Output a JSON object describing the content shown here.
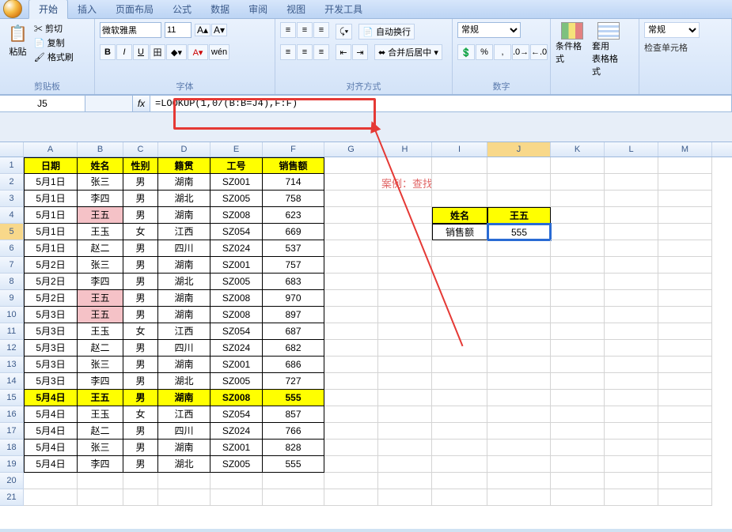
{
  "tabs": [
    "开始",
    "插入",
    "页面布局",
    "公式",
    "数据",
    "审阅",
    "视图",
    "开发工具"
  ],
  "tabs_active_index": 0,
  "ribbon": {
    "groups": {
      "clipboard": {
        "label": "剪贴板",
        "paste": "粘贴",
        "cut": "剪切",
        "copy": "复制",
        "format_painter": "格式刷"
      },
      "font": {
        "label": "字体",
        "name": "微软雅黑",
        "size": "11"
      },
      "align": {
        "label": "对齐方式",
        "wrap": "自动换行",
        "merge": "合并后居中"
      },
      "number": {
        "label": "数字",
        "format": "常规"
      },
      "styles": {
        "cond": "条件格式",
        "table": "套用\n表格格式",
        "cell_label": "常规",
        "check": "检查单元格"
      }
    }
  },
  "formula_bar": {
    "name_box": "J5",
    "formula": "=LOOKUP(1,0/(B:B=J4),F:F)"
  },
  "columns": [
    "A",
    "B",
    "C",
    "D",
    "E",
    "F",
    "G",
    "H",
    "I",
    "J",
    "K",
    "L",
    "M"
  ],
  "col_active_index": 9,
  "row_active_index": 5,
  "headers": [
    "日期",
    "姓名",
    "性别",
    "籍贯",
    "工号",
    "销售额"
  ],
  "rows": [
    {
      "d": "5月1日",
      "n": "张三",
      "g": "男",
      "p": "湖南",
      "id": "SZ001",
      "v": "714"
    },
    {
      "d": "5月1日",
      "n": "李四",
      "g": "男",
      "p": "湖北",
      "id": "SZ005",
      "v": "758"
    },
    {
      "d": "5月1日",
      "n": "王五",
      "g": "男",
      "p": "湖南",
      "id": "SZ008",
      "v": "623",
      "pink": true
    },
    {
      "d": "5月1日",
      "n": "王玉",
      "g": "女",
      "p": "江西",
      "id": "SZ054",
      "v": "669"
    },
    {
      "d": "5月1日",
      "n": "赵二",
      "g": "男",
      "p": "四川",
      "id": "SZ024",
      "v": "537"
    },
    {
      "d": "5月2日",
      "n": "张三",
      "g": "男",
      "p": "湖南",
      "id": "SZ001",
      "v": "757"
    },
    {
      "d": "5月2日",
      "n": "李四",
      "g": "男",
      "p": "湖北",
      "id": "SZ005",
      "v": "683"
    },
    {
      "d": "5月2日",
      "n": "王五",
      "g": "男",
      "p": "湖南",
      "id": "SZ008",
      "v": "970",
      "pink": true
    },
    {
      "d": "5月3日",
      "n": "王五",
      "g": "男",
      "p": "湖南",
      "id": "SZ008",
      "v": "897",
      "pink": true
    },
    {
      "d": "5月3日",
      "n": "王玉",
      "g": "女",
      "p": "江西",
      "id": "SZ054",
      "v": "687"
    },
    {
      "d": "5月3日",
      "n": "赵二",
      "g": "男",
      "p": "四川",
      "id": "SZ024",
      "v": "682"
    },
    {
      "d": "5月3日",
      "n": "张三",
      "g": "男",
      "p": "湖南",
      "id": "SZ001",
      "v": "686"
    },
    {
      "d": "5月3日",
      "n": "李四",
      "g": "男",
      "p": "湖北",
      "id": "SZ005",
      "v": "727"
    },
    {
      "d": "5月4日",
      "n": "王五",
      "g": "男",
      "p": "湖南",
      "id": "SZ008",
      "v": "555",
      "yellow": true
    },
    {
      "d": "5月4日",
      "n": "王玉",
      "g": "女",
      "p": "江西",
      "id": "SZ054",
      "v": "857"
    },
    {
      "d": "5月4日",
      "n": "赵二",
      "g": "男",
      "p": "四川",
      "id": "SZ024",
      "v": "766"
    },
    {
      "d": "5月4日",
      "n": "张三",
      "g": "男",
      "p": "湖南",
      "id": "SZ001",
      "v": "828"
    },
    {
      "d": "5月4日",
      "n": "李四",
      "g": "男",
      "p": "湖北",
      "id": "SZ005",
      "v": "555"
    }
  ],
  "annotation": "案例：查找出王五最后一天的销售额",
  "lookup": {
    "name_label": "姓名",
    "name_value": "王五",
    "sales_label": "销售额",
    "sales_value": "555"
  }
}
